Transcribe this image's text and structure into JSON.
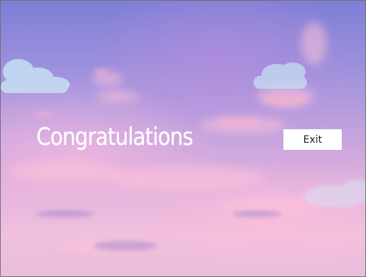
{
  "screen": {
    "title": "Congratulations",
    "exit_label": "Exit"
  },
  "colors": {
    "sky_top": "#7d7fd6",
    "sky_bottom": "#f0c0dc",
    "cloud": "#c8e4f4",
    "title_text": "#ffffff",
    "button_bg": "#ffffff"
  }
}
